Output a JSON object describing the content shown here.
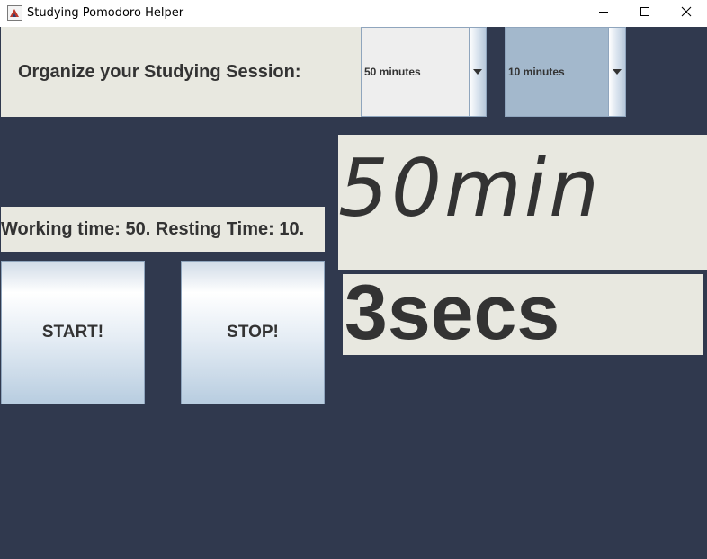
{
  "window": {
    "title": "Studying Pomodoro Helper",
    "icon": "java-app-icon"
  },
  "header": {
    "label": "Organize your Studying Session:"
  },
  "work_combo": {
    "selected": "50 minutes"
  },
  "rest_combo": {
    "selected": "10 minutes"
  },
  "status": {
    "text": "Working time: 50. Resting Time: 10."
  },
  "buttons": {
    "start_label": "START!",
    "stop_label": "STOP!"
  },
  "timer": {
    "minutes_text": "50min",
    "seconds_text": "3secs"
  },
  "colors": {
    "background": "#30394e",
    "panel": "#e8e8e0",
    "text": "#333333"
  }
}
